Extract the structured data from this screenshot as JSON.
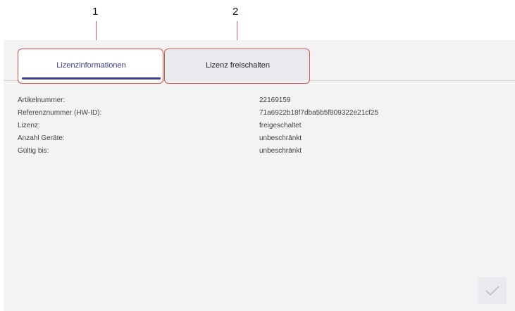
{
  "callouts": [
    "1",
    "2"
  ],
  "tabs": [
    {
      "label": "Lizenzinformationen",
      "active": true
    },
    {
      "label": "Lizenz freischalten",
      "active": false
    }
  ],
  "info_rows": [
    {
      "label": "Artikelnummer:",
      "value": "22169159"
    },
    {
      "label": "Referenznummer (HW-ID):",
      "value": "71a6922b18f7dba5b5f809322e21cf25"
    },
    {
      "label": "Lizenz:",
      "value": "freigeschaltet"
    },
    {
      "label": "Anzahl Geräte:",
      "value": "unbeschränkt"
    },
    {
      "label": "Gültig bis:",
      "value": "unbeschränkt"
    }
  ],
  "icons": {
    "confirm": "checkmark-icon"
  },
  "colors": {
    "accent": "#3b3b8a",
    "callout": "#d9534f",
    "panel_bg": "#f3f3f3"
  }
}
